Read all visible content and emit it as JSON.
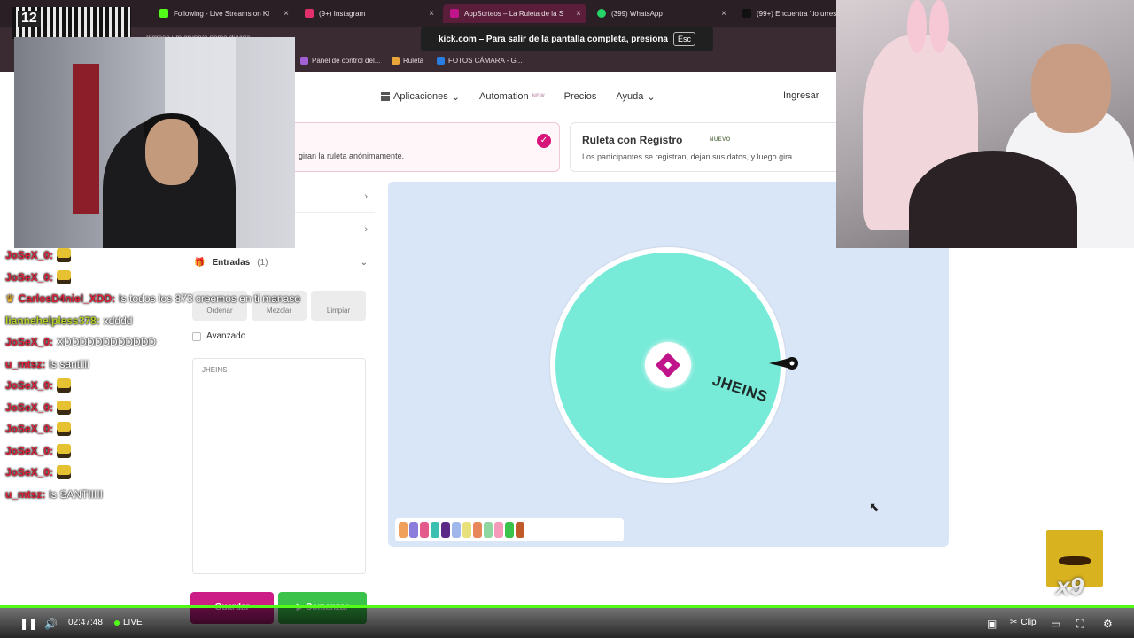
{
  "browser": {
    "tabs": [
      {
        "label": "Following - Live Streams on Ki",
        "color": "#53fc18"
      },
      {
        "label": "(9+) Instagram",
        "color": "#e1306c"
      },
      {
        "label": "AppSorteos – La Ruleta de la S",
        "color": "#c0158a"
      },
      {
        "label": "(399) WhatsApp",
        "color": "#25d366"
      },
      {
        "label": "(99+) Encuentra 'tio urres",
        "color": "#111111"
      }
    ],
    "url_fragment": "Ingrese um grupo/a nome duvida",
    "bookmarks": [
      {
        "label": "Panel de control del...",
        "color": "#a35fd6"
      },
      {
        "label": "Ruleta",
        "color": "#e8a53a"
      },
      {
        "label": "FOTOS CÁMARA - G...",
        "color": "#2a7de1"
      }
    ],
    "fullscreen_toast": {
      "text": "kick.com – Para salir de la pantalla completa, presiona",
      "key": "Esc"
    }
  },
  "site": {
    "nav": [
      {
        "label": "Aplicaciones",
        "badge": ""
      },
      {
        "label": "Automation",
        "badge": "NEW"
      },
      {
        "label": "Precios",
        "badge": ""
      },
      {
        "label": "Ayuda",
        "badge": ""
      }
    ],
    "login": "Ingresar",
    "card_anon": {
      "text": "giran la ruleta anónimamente."
    },
    "card_registro": {
      "title": "Ruleta con Registro",
      "badge": "NUEVO",
      "subtitle": "Los participantes se registran, dejan sus datos, y luego gira"
    },
    "entradas": {
      "label": "Entradas",
      "count": "(1)"
    },
    "tools": [
      "Ordenar",
      "Mezclar",
      "Limpiar"
    ],
    "avanzado": "Avanzado",
    "entries_text": "JHEINS",
    "buttons": {
      "guardar": "Guardar",
      "comenzar": "▶ Comenzar"
    },
    "wheel": {
      "segment_label": "JHEINS",
      "segment_color": "#78ead8"
    },
    "palette": [
      "#f0a05a",
      "#8a7ddc",
      "#e45a8a",
      "#3bbfb0",
      "#5b2a86",
      "#9fb7ea",
      "#e8e07a",
      "#e8875a",
      "#8fd6a0",
      "#f59ab8",
      "#3ac24a",
      "#c05a2a"
    ]
  },
  "chat": [
    {
      "user": "JoSeX_0:",
      "color": "#e0223a",
      "body": "",
      "emote": true,
      "crown": false
    },
    {
      "user": "JoSeX_0:",
      "color": "#e0223a",
      "body": "",
      "emote": true,
      "crown": false
    },
    {
      "user": "CarlosD4niel_XDD:",
      "color": "#e0223a",
      "body": "ls todos los 873 creemos en ti manaso",
      "emote": false,
      "crown": true
    },
    {
      "user": "liannehelpless378:",
      "color": "#b5d12a",
      "body": "xdddd",
      "emote": false,
      "crown": false
    },
    {
      "user": "JoSeX_0:",
      "color": "#e0223a",
      "body": "XDDDDDDDDDDDD",
      "emote": false,
      "crown": false
    },
    {
      "user": "u_mtsz:",
      "color": "#e0223a",
      "body": "ls santiiii",
      "emote": false,
      "crown": false
    },
    {
      "user": "JoSeX_0:",
      "color": "#e0223a",
      "body": "",
      "emote": true,
      "crown": false
    },
    {
      "user": "JoSeX_0:",
      "color": "#e0223a",
      "body": "",
      "emote": true,
      "crown": false
    },
    {
      "user": "JoSeX_0:",
      "color": "#e0223a",
      "body": "",
      "emote": true,
      "crown": false
    },
    {
      "user": "JoSeX_0:",
      "color": "#e0223a",
      "body": "",
      "emote": true,
      "crown": false
    },
    {
      "user": "JoSeX_0:",
      "color": "#e0223a",
      "body": "",
      "emote": true,
      "crown": false
    },
    {
      "user": "u_mtsz:",
      "color": "#e0223a",
      "body": "ls SANTIIIII",
      "emote": false,
      "crown": false
    }
  ],
  "overlay": {
    "qr_count": "12",
    "gif_multiplier": "x9"
  },
  "player": {
    "time": "02:47:48",
    "live": "LIVE",
    "clip": "Clip"
  }
}
